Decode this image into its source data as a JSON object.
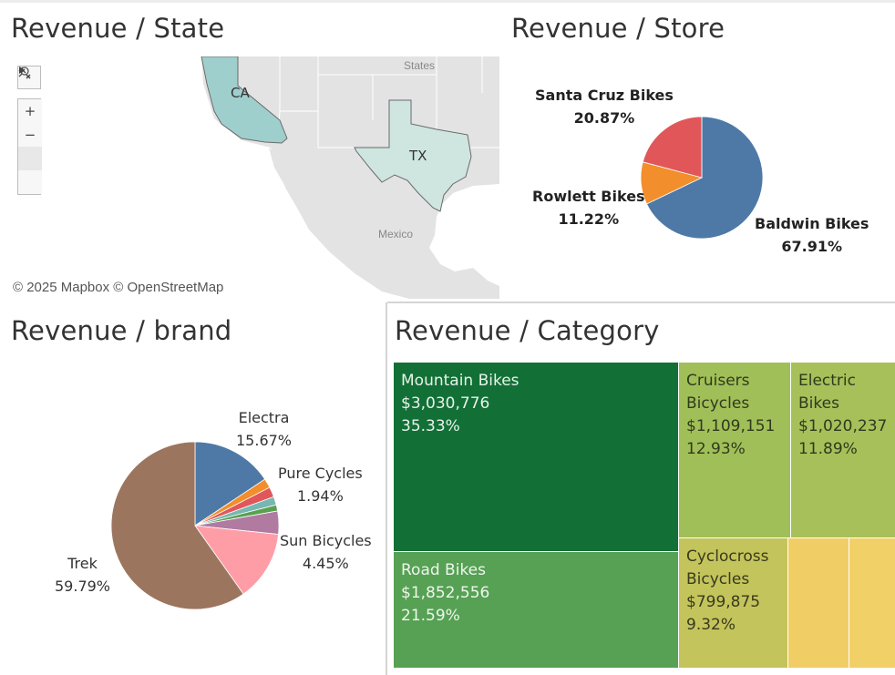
{
  "titles": {
    "state": "Revenue / State",
    "store": "Revenue / Store",
    "brand": "Revenue / brand",
    "category": "Revenue / Category"
  },
  "map": {
    "states": [
      {
        "code": "CA",
        "color": "#9fcfcc"
      },
      {
        "code": "TX",
        "color": "#cfe6e0"
      }
    ],
    "place_labels": {
      "states": "States",
      "mexico": "Mexico"
    },
    "attribution": "© 2025 Mapbox © OpenStreetMap",
    "tools": {
      "search": "search-icon",
      "zoom_in": "+",
      "zoom_out": "−",
      "pin": "unpin-icon",
      "expand": "play-icon"
    }
  },
  "chart_data": [
    {
      "type": "pie",
      "id": "store",
      "slices": [
        {
          "name": "Baldwin Bikes",
          "value": 67.91,
          "label": "67.91%",
          "color": "#4e79a7"
        },
        {
          "name": "Rowlett Bikes",
          "value": 11.22,
          "label": "11.22%",
          "color": "#f28e2b"
        },
        {
          "name": "Santa Cruz Bikes",
          "value": 20.87,
          "label": "20.87%",
          "color": "#e15759"
        }
      ]
    },
    {
      "type": "pie",
      "id": "brand",
      "slices": [
        {
          "name": "Electra",
          "value": 15.67,
          "label": "15.67%",
          "color": "#4e79a7"
        },
        {
          "name": "",
          "value": 1.8,
          "label": "",
          "color": "#f28e2b"
        },
        {
          "name": "Pure Cycles",
          "value": 1.94,
          "label": "1.94%",
          "color": "#e15759"
        },
        {
          "name": "",
          "value": 1.6,
          "label": "",
          "color": "#76b7b2"
        },
        {
          "name": "",
          "value": 1.2,
          "label": "",
          "color": "#59a14f"
        },
        {
          "name": "Sun Bicycles",
          "value": 4.45,
          "label": "4.45%",
          "color": "#b07aa1"
        },
        {
          "name": "",
          "value": 13.55,
          "label": "",
          "color": "#ff9da7"
        },
        {
          "name": "Trek",
          "value": 59.79,
          "label": "59.79%",
          "color": "#9c755f"
        }
      ]
    },
    {
      "type": "treemap",
      "id": "category",
      "tiles": [
        {
          "name": "Mountain Bikes",
          "value": "$3,030,776",
          "pct": "35.33%",
          "color": "#127036",
          "text": "#e8f2ea"
        },
        {
          "name": "Road Bikes",
          "value": "$1,852,556",
          "pct": "21.59%",
          "color": "#56a154",
          "text": "#eef6ec"
        },
        {
          "name": "Cruisers Bicycles",
          "value": "$1,109,151",
          "pct": "12.93%",
          "color": "#a0bf58",
          "text": "#2f3a1d"
        },
        {
          "name": "Electric Bikes",
          "value": "$1,020,237",
          "pct": "11.89%",
          "color": "#a7c05a",
          "text": "#2f3a1d"
        },
        {
          "name": "Cyclocross Bicycles",
          "value": "$799,875",
          "pct": "9.32%",
          "color": "#c3c45b",
          "text": "#3a3a1d"
        },
        {
          "name": "",
          "value": "",
          "pct": "",
          "color": "#f1cd66",
          "text": "#333"
        },
        {
          "name": "",
          "value": "",
          "pct": "",
          "color": "#f2d068",
          "text": "#333"
        }
      ]
    }
  ],
  "labels": {
    "store": {
      "santa_cruz": {
        "name": "Santa Cruz Bikes",
        "pct": "20.87%"
      },
      "rowlett": {
        "name": "Rowlett Bikes",
        "pct": "11.22%"
      },
      "baldwin": {
        "name": "Baldwin Bikes",
        "pct": "67.91%"
      }
    },
    "brand": {
      "electra": {
        "name": "Electra",
        "pct": "15.67%"
      },
      "pure": {
        "name": "Pure Cycles",
        "pct": "1.94%"
      },
      "sun": {
        "name": "Sun Bicycles",
        "pct": "4.45%"
      },
      "trek": {
        "name": "Trek",
        "pct": "59.79%"
      }
    },
    "category": {
      "mountain": {
        "l1": "Mountain Bikes",
        "l2": "$3,030,776",
        "l3": "35.33%"
      },
      "road": {
        "l1": "Road Bikes",
        "l2": "$1,852,556",
        "l3": "21.59%"
      },
      "cruisers": {
        "l1": "Cruisers",
        "l2": "Bicycles",
        "l3": "$1,109,151",
        "l4": "12.93%"
      },
      "electric": {
        "l1": "Electric",
        "l2": "Bikes",
        "l3": "$1,020,237",
        "l4": "11.89%"
      },
      "cyclocross": {
        "l1": "Cyclocross",
        "l2": "Bicycles",
        "l3": "$799,875",
        "l4": "9.32%"
      }
    }
  }
}
